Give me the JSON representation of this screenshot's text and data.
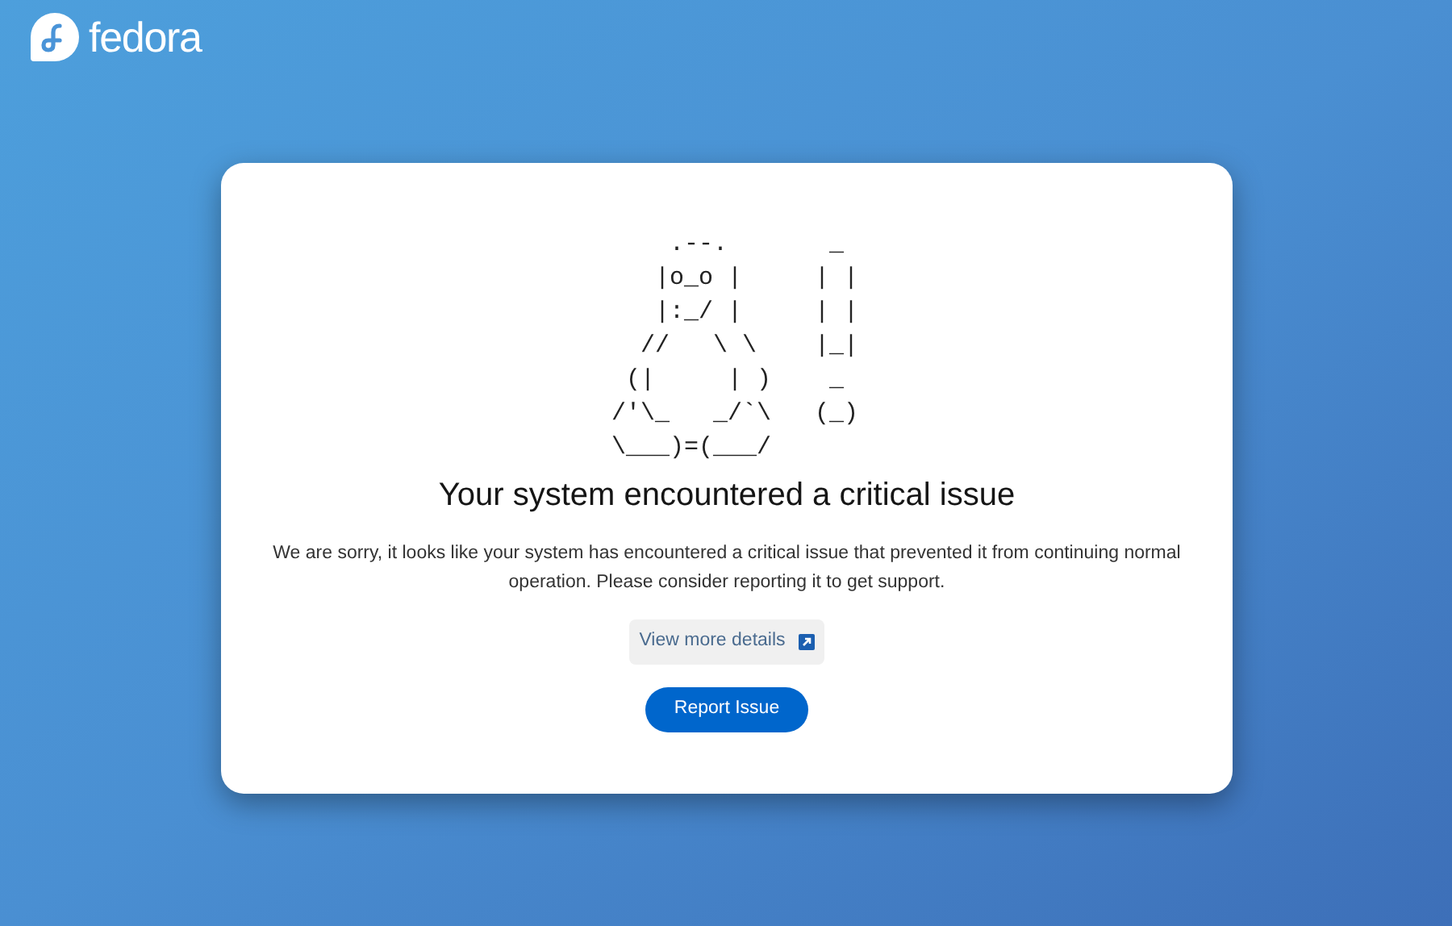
{
  "brand": {
    "name": "fedora"
  },
  "dialog": {
    "ascii_art": [
      "    .--.       _",
      "   |o_o |     | |",
      "   |:_/ |     | |",
      "  //   \\ \\    |_|",
      " (|     | )    _",
      "/'\\_   _/`\\   (_)",
      "\\___)=(___/"
    ],
    "title": "Your system encountered a critical issue",
    "message": "We are sorry, it looks like your system has encountered a critical issue that prevented it from continuing normal operation. Please consider reporting it to get support.",
    "details_link": "View more details",
    "report_button": "Report Issue"
  }
}
